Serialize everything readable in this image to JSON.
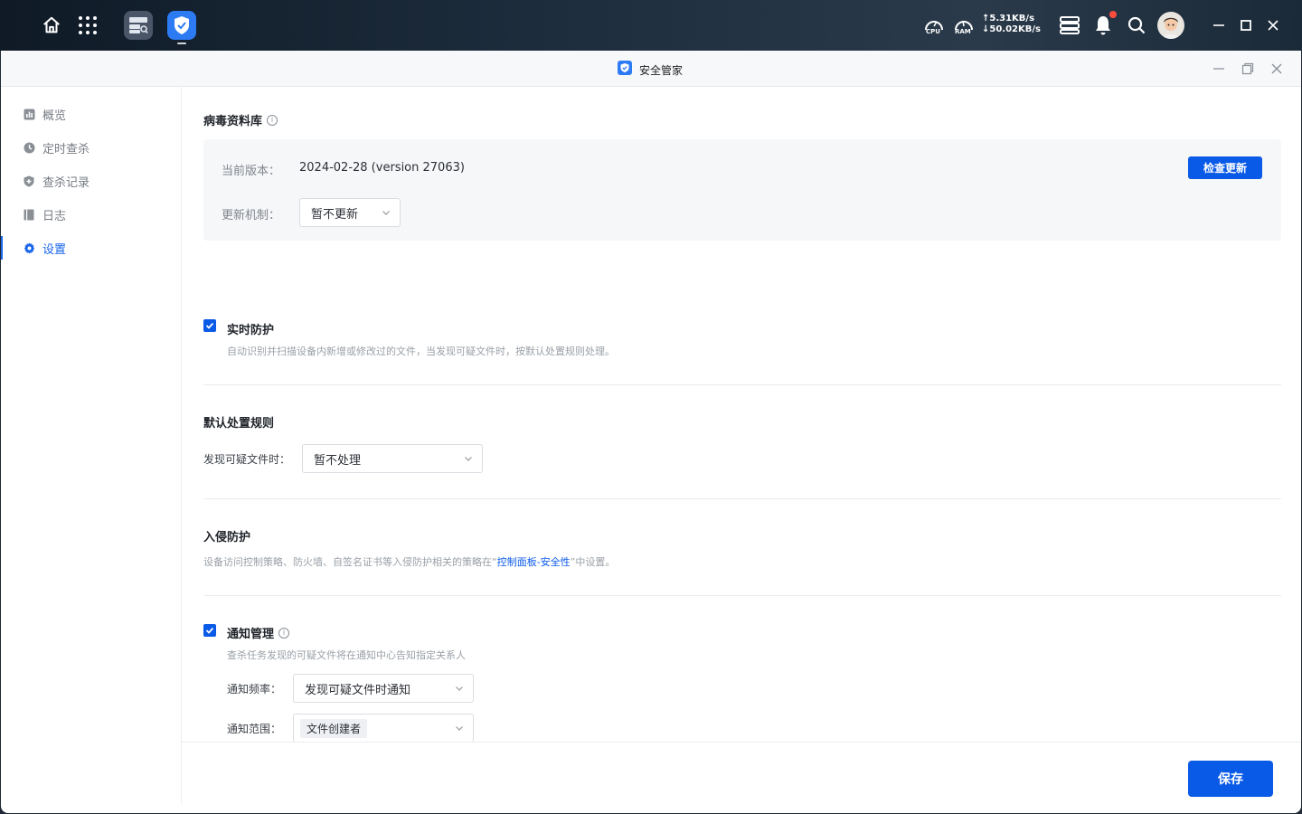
{
  "system_bar": {
    "cpu_label": "CPU",
    "ram_label": "RAM",
    "upload": "↑5.31KB/s",
    "download": "↓50.02KB/s"
  },
  "window": {
    "title": "安全管家"
  },
  "sidebar": {
    "items": [
      {
        "label": "概览",
        "icon": "overview-icon"
      },
      {
        "label": "定时查杀",
        "icon": "clock-icon"
      },
      {
        "label": "查杀记录",
        "icon": "shield-plus-icon"
      },
      {
        "label": "日志",
        "icon": "log-book-icon"
      },
      {
        "label": "设置",
        "icon": "gear-icon",
        "active": true
      }
    ]
  },
  "virus_db": {
    "title": "病毒资料库",
    "version_label": "当前版本：",
    "version_value": "2024-02-28 (version 27063)",
    "check_update_label": "检查更新",
    "update_mode_label": "更新机制：",
    "update_mode_value": "暂不更新"
  },
  "realtime": {
    "title": "实时防护",
    "checked": true,
    "desc": "自动识别并扫描设备内新增或修改过的文件，当发现可疑文件时，按默认处置规则处理。"
  },
  "default_rule": {
    "title": "默认处置规则",
    "label": "发现可疑文件时：",
    "value": "暂不处理"
  },
  "intrusion": {
    "title": "入侵防护",
    "desc_prefix": "设备访问控制策略、防火墙、自签名证书等入侵防护相关的策略在“",
    "desc_link": "控制面板-安全性",
    "desc_suffix": "”中设置。"
  },
  "notification": {
    "title": "通知管理",
    "checked": true,
    "desc": "查杀任务发现的可疑文件将在通知中心告知指定关系人",
    "frequency_label": "通知频率：",
    "frequency_value": "发现可疑文件时通知",
    "scope_label": "通知范围：",
    "scope_value": "文件创建者"
  },
  "footer": {
    "save_label": "保存"
  },
  "colors": {
    "accent": "#0a5ae8",
    "badge": "#ff4d3d"
  }
}
